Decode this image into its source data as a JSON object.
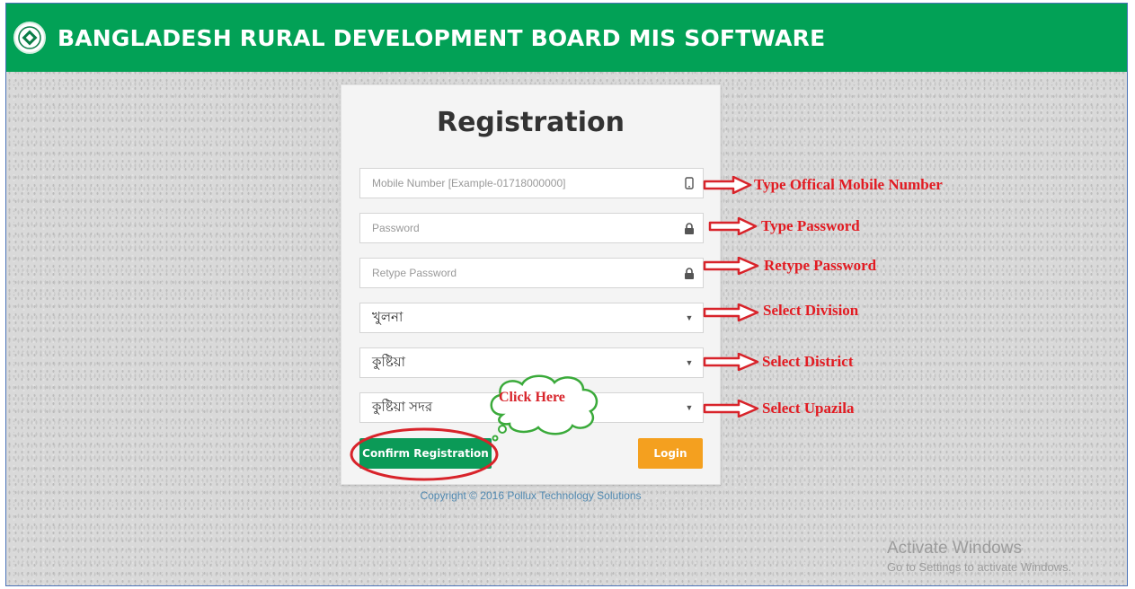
{
  "header": {
    "title": "BANGLADESH RURAL DEVELOPMENT BOARD MIS SOFTWARE",
    "color": "#02a156"
  },
  "form": {
    "title": "Registration",
    "mobile_placeholder": "Mobile Number [Example-01718000000]",
    "password_placeholder": "Password",
    "retype_placeholder": "Retype Password",
    "division_value": "খুলনা",
    "district_value": "কুষ্টিয়া",
    "upazila_value": "কুষ্টিয়া সদর",
    "confirm_label": "Confirm Registration",
    "login_label": "Login"
  },
  "footer": {
    "copyright": "Copyright © 2016 Pollux Technology Solutions"
  },
  "annotations": {
    "mobile": "Type Offical Mobile Number",
    "password": "Type Password",
    "retype": "Retype Password",
    "division": "Select Division",
    "district": "Select District",
    "upazila": "Select Upazila",
    "click_here": "Click Here"
  },
  "watermark": {
    "line1": "Activate Windows",
    "line2": "Go to Settings to activate Windows."
  },
  "icons": {
    "mobile": "mobile-phone-icon",
    "lock": "lock-icon",
    "caret": "caret-down-icon"
  },
  "colors": {
    "accent_green": "#0b9a57",
    "login_orange": "#f4a01f",
    "annotation_red": "#e21b22",
    "cloud_green": "#3aaa3a"
  }
}
